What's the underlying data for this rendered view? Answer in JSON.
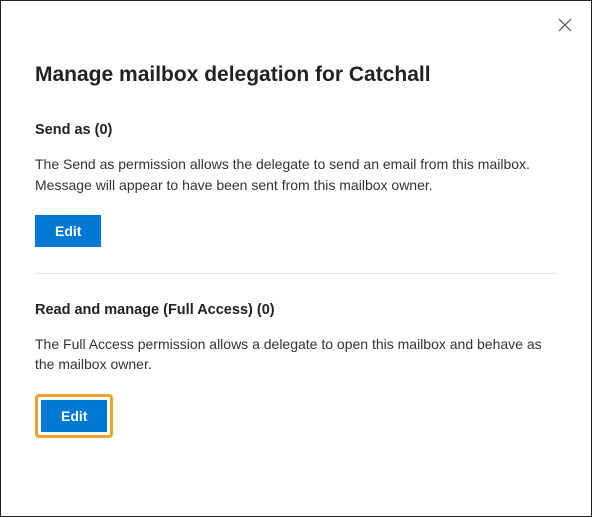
{
  "title": "Manage mailbox delegation for Catchall",
  "sections": {
    "sendAs": {
      "heading": "Send as (0)",
      "description": "The Send as permission allows the delegate to send an email from this mailbox. Message will appear to have been sent from this mailbox owner.",
      "buttonLabel": "Edit"
    },
    "fullAccess": {
      "heading": "Read and manage (Full Access) (0)",
      "description": "The Full Access permission allows a delegate to open this mailbox and behave as the mailbox owner.",
      "buttonLabel": "Edit"
    }
  }
}
